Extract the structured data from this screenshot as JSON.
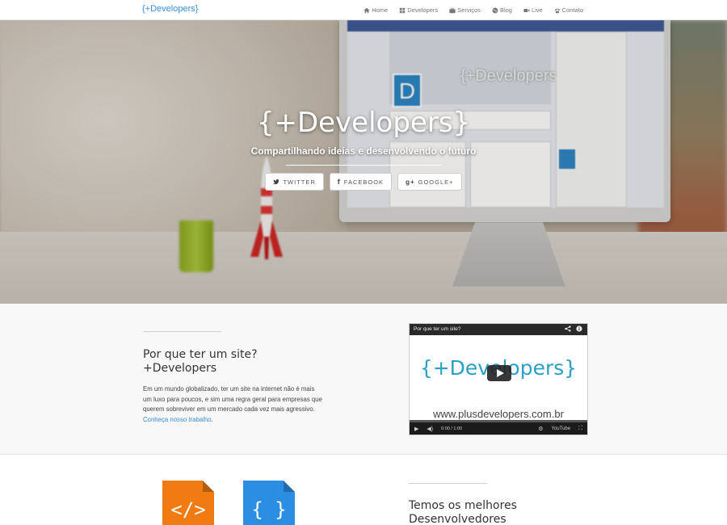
{
  "navbar": {
    "brand": "{+Developers}",
    "items": [
      {
        "label": "Home",
        "icon": "home-icon"
      },
      {
        "label": "Developers",
        "icon": "grid-icon"
      },
      {
        "label": "Serviços",
        "icon": "briefcase-icon"
      },
      {
        "label": "Blog",
        "icon": "globe-icon"
      },
      {
        "label": "Live",
        "icon": "video-camera-icon"
      },
      {
        "label": "Contato",
        "icon": "phone-icon"
      }
    ]
  },
  "hero": {
    "title": "{+Developers}",
    "subtitle": "Compartilhando ideias e desenvolvendo o futuro",
    "screen_text": "{+Developers}",
    "buttons": [
      {
        "label": "TWITTER",
        "icon": "twitter-icon"
      },
      {
        "label": "FACEBOOK",
        "icon": "facebook-icon"
      },
      {
        "label": "GOOGLE+",
        "icon": "google-plus-icon"
      }
    ]
  },
  "section_why": {
    "title_line1": "Por que ter um site?",
    "title_line2": "+Developers",
    "text": "Em um mundo globalizado, ter um site na internet não é mais um luxo para poucos, e sim uma regra geral para empresas que querem sobreviver em um mercado cada vez mais agressivo.",
    "link": "Conheça nosso trabalho",
    "text_end": "."
  },
  "video": {
    "title": "Por que ter um site?",
    "logo_text": "{+Developers}",
    "url_text": "www.plusdevelopers.com.br",
    "time": "0:00 / 1:00"
  },
  "section_devs": {
    "title_line1": "Temos os melhores",
    "title_line2": "Desenvolvedores",
    "file_icons": [
      {
        "label": "</>",
        "color": "#f07b13"
      },
      {
        "label": "{ }",
        "color": "#2b8ee3"
      }
    ]
  }
}
